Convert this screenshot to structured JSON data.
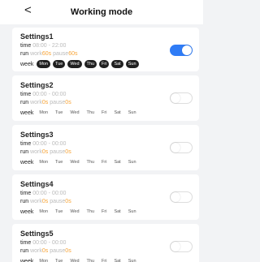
{
  "header": {
    "back_icon": "chevron-left-icon",
    "back_glyph": "<",
    "title": "Working mode"
  },
  "labels": {
    "time": "time",
    "run": "run",
    "work": "work",
    "pause": "pause",
    "week": "week"
  },
  "accent_color": "#2f7cf6",
  "value_color": "#f7a437",
  "settings": [
    {
      "name": "Settings1",
      "time": "08:00 - 22:00",
      "work": "60s",
      "pause": "60s",
      "enabled": true,
      "days": [
        {
          "label": "Mon",
          "active": true
        },
        {
          "label": "Tue",
          "active": true
        },
        {
          "label": "Wed",
          "active": true
        },
        {
          "label": "Thu",
          "active": true
        },
        {
          "label": "Fri",
          "active": true
        },
        {
          "label": "Sat",
          "active": true
        },
        {
          "label": "Sun",
          "active": true
        }
      ]
    },
    {
      "name": "Settings2",
      "time": "00:00 - 00:00",
      "work": "0s",
      "pause": "0s",
      "enabled": false,
      "days": [
        {
          "label": "Mon",
          "active": false
        },
        {
          "label": "Tue",
          "active": false
        },
        {
          "label": "Wed",
          "active": false
        },
        {
          "label": "Thu",
          "active": false
        },
        {
          "label": "Fri",
          "active": false
        },
        {
          "label": "Sat",
          "active": false
        },
        {
          "label": "Sun",
          "active": false
        }
      ]
    },
    {
      "name": "Settings3",
      "time": "00:00 - 00:00",
      "work": "0s",
      "pause": "0s",
      "enabled": false,
      "days": [
        {
          "label": "Mon",
          "active": false
        },
        {
          "label": "Tue",
          "active": false
        },
        {
          "label": "Wed",
          "active": false
        },
        {
          "label": "Thu",
          "active": false
        },
        {
          "label": "Fri",
          "active": false
        },
        {
          "label": "Sat",
          "active": false
        },
        {
          "label": "Sun",
          "active": false
        }
      ]
    },
    {
      "name": "Settings4",
      "time": "00:00 - 00:00",
      "work": "0s",
      "pause": "0s",
      "enabled": false,
      "days": [
        {
          "label": "Mon",
          "active": false
        },
        {
          "label": "Tue",
          "active": false
        },
        {
          "label": "Wed",
          "active": false
        },
        {
          "label": "Thu",
          "active": false
        },
        {
          "label": "Fri",
          "active": false
        },
        {
          "label": "Sat",
          "active": false
        },
        {
          "label": "Sun",
          "active": false
        }
      ]
    },
    {
      "name": "Settings5",
      "time": "00:00 - 00:00",
      "work": "0s",
      "pause": "0s",
      "enabled": false,
      "days": [
        {
          "label": "Mon",
          "active": false
        },
        {
          "label": "Tue",
          "active": false
        },
        {
          "label": "Wed",
          "active": false
        },
        {
          "label": "Thu",
          "active": false
        },
        {
          "label": "Fri",
          "active": false
        },
        {
          "label": "Sat",
          "active": false
        },
        {
          "label": "Sun",
          "active": false
        }
      ]
    }
  ]
}
